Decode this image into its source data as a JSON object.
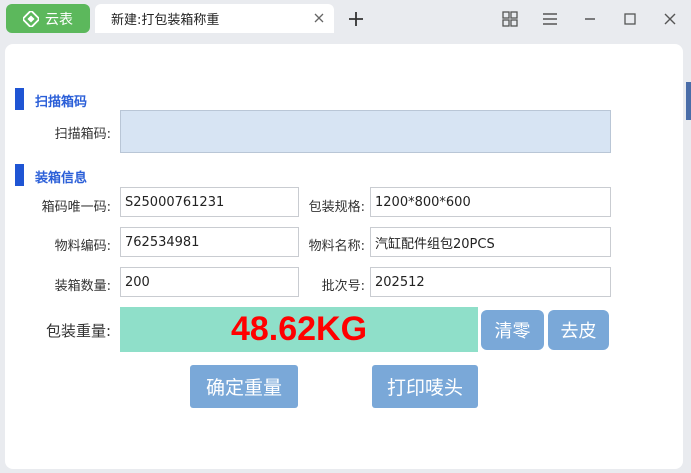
{
  "titlebar": {
    "app_label": "云表",
    "tab_title": "新建:打包装箱称重"
  },
  "scan_section": {
    "title": "扫描箱码",
    "scan_label": "扫描箱码:",
    "scan_value": ""
  },
  "packing_section": {
    "title": "装箱信息",
    "box_unique_code_label": "箱码唯一码:",
    "box_unique_code_value": "S25000761231",
    "pack_spec_label": "包装规格:",
    "pack_spec_value": "1200*800*600",
    "material_code_label": "物料编码:",
    "material_code_value": "762534981",
    "material_name_label": "物料名称:",
    "material_name_value": "汽缸配件组包20PCS",
    "pack_qty_label": "装箱数量:",
    "pack_qty_value": "200",
    "batch_no_label": "批次号:",
    "batch_no_value": "202512"
  },
  "weight": {
    "label": "包装重量:",
    "value": "48.62KG",
    "zero_button": "清零",
    "tare_button": "去皮"
  },
  "actions": {
    "confirm_button": "确定重量",
    "print_button": "打印唛头"
  },
  "colors": {
    "accent": "#1f55d4",
    "app_button": "#5cb85c",
    "weight_bg": "#8fdfc9",
    "weight_text": "#ff0000",
    "button_bg": "#7aa8d8"
  }
}
